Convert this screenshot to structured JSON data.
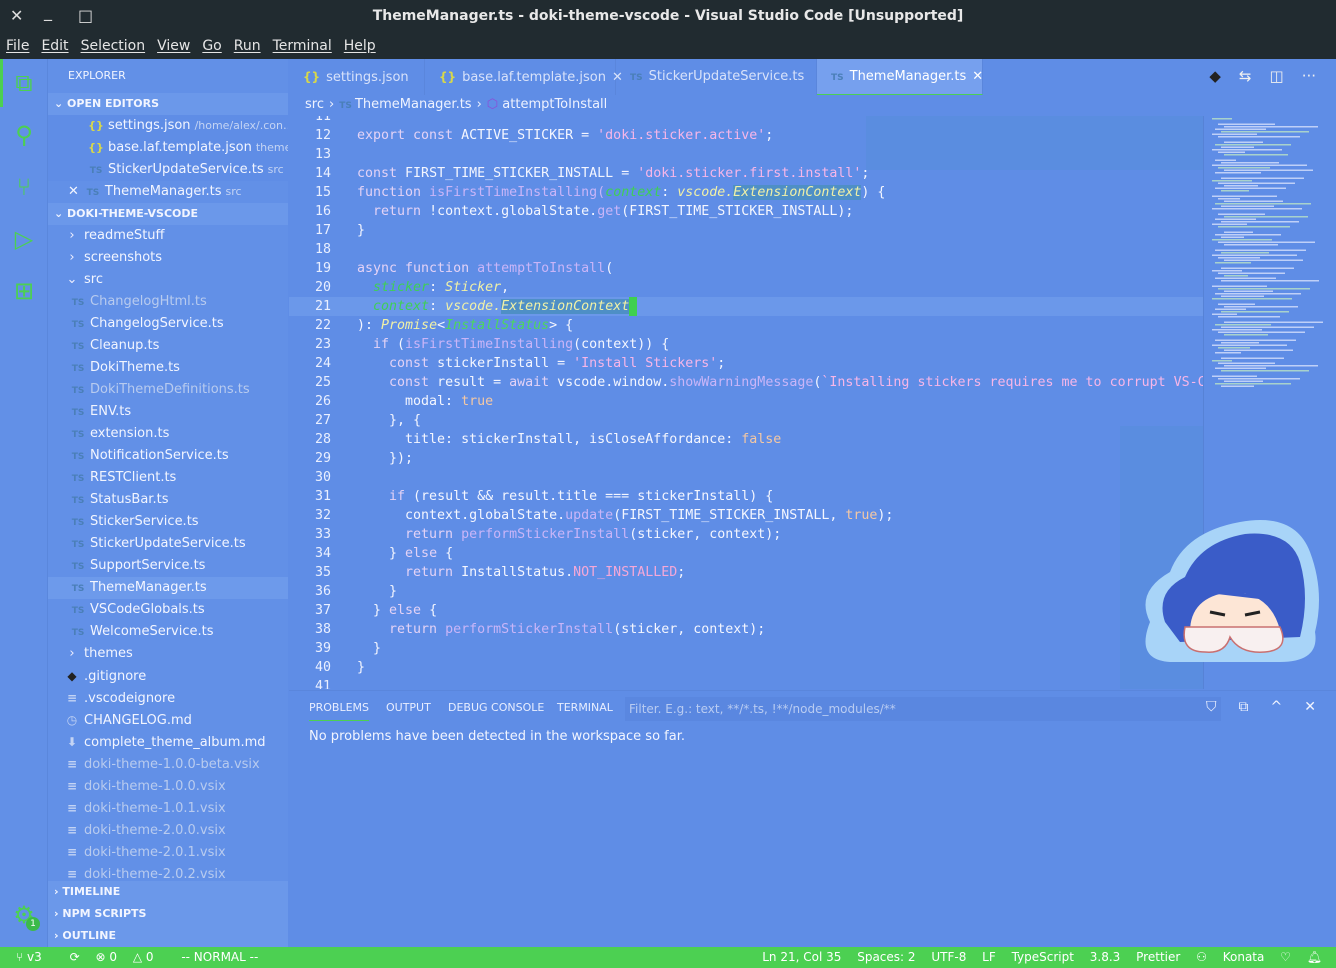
{
  "window": {
    "title": "ThemeManager.ts - doki-theme-vscode - Visual Studio Code [Unsupported]",
    "close": "✕",
    "minimize": "_",
    "maximize": "□"
  },
  "menu": [
    "File",
    "Edit",
    "Selection",
    "View",
    "Go",
    "Run",
    "Terminal",
    "Help"
  ],
  "activity": [
    {
      "icon": "files-icon"
    },
    {
      "icon": "search-icon"
    },
    {
      "icon": "source-control-icon"
    },
    {
      "icon": "run-debug-icon"
    },
    {
      "icon": "extensions-icon"
    },
    {
      "icon": "settings-gear-icon",
      "badge": "1"
    }
  ],
  "sidebar": {
    "title": "EXPLORER",
    "open_editors": {
      "label": "OPEN EDITORS",
      "items": [
        {
          "icon": "{}",
          "name": "settings.json",
          "desc": "/home/alex/.con…"
        },
        {
          "icon": "{}",
          "name": "base.laf.template.json",
          "desc": "theme…"
        },
        {
          "icon": "TS",
          "name": "StickerUpdateService.ts",
          "desc": "src"
        },
        {
          "icon": "TS",
          "name": "ThemeManager.ts",
          "desc": "src",
          "close": "✕"
        }
      ]
    },
    "project": {
      "label": "DOKI-THEME-VSCODE",
      "items": [
        {
          "indent": 1,
          "icon": "›",
          "name": "readmeStuff"
        },
        {
          "indent": 1,
          "icon": "›",
          "name": "screenshots"
        },
        {
          "indent": 1,
          "icon": "⌄",
          "name": "src"
        },
        {
          "indent": 2,
          "icon": "TS",
          "name": "ChangelogHtml.ts",
          "dim": true
        },
        {
          "indent": 2,
          "icon": "TS",
          "name": "ChangelogService.ts"
        },
        {
          "indent": 2,
          "icon": "TS",
          "name": "Cleanup.ts"
        },
        {
          "indent": 2,
          "icon": "TS",
          "name": "DokiTheme.ts"
        },
        {
          "indent": 2,
          "icon": "TS",
          "name": "DokiThemeDefinitions.ts",
          "dim": true
        },
        {
          "indent": 2,
          "icon": "TS",
          "name": "ENV.ts"
        },
        {
          "indent": 2,
          "icon": "TS",
          "name": "extension.ts"
        },
        {
          "indent": 2,
          "icon": "TS",
          "name": "NotificationService.ts"
        },
        {
          "indent": 2,
          "icon": "TS",
          "name": "RESTClient.ts"
        },
        {
          "indent": 2,
          "icon": "TS",
          "name": "StatusBar.ts"
        },
        {
          "indent": 2,
          "icon": "TS",
          "name": "StickerService.ts"
        },
        {
          "indent": 2,
          "icon": "TS",
          "name": "StickerUpdateService.ts"
        },
        {
          "indent": 2,
          "icon": "TS",
          "name": "SupportService.ts"
        },
        {
          "indent": 2,
          "icon": "TS",
          "name": "ThemeManager.ts",
          "selected": true
        },
        {
          "indent": 2,
          "icon": "TS",
          "name": "VSCodeGlobals.ts"
        },
        {
          "indent": 2,
          "icon": "TS",
          "name": "WelcomeService.ts"
        },
        {
          "indent": 1,
          "icon": "›",
          "name": "themes"
        },
        {
          "indent": 1,
          "icon": "◆",
          "name": ".gitignore"
        },
        {
          "indent": 1,
          "icon": "≡",
          "name": ".vscodeignore"
        },
        {
          "indent": 1,
          "icon": "◷",
          "name": "CHANGELOG.md"
        },
        {
          "indent": 1,
          "icon": "⬇",
          "name": "complete_theme_album.md"
        },
        {
          "indent": 1,
          "icon": "≡",
          "name": "doki-theme-1.0.0-beta.vsix",
          "dim": true
        },
        {
          "indent": 1,
          "icon": "≡",
          "name": "doki-theme-1.0.0.vsix",
          "dim": true
        },
        {
          "indent": 1,
          "icon": "≡",
          "name": "doki-theme-1.0.1.vsix",
          "dim": true
        },
        {
          "indent": 1,
          "icon": "≡",
          "name": "doki-theme-2.0.0.vsix",
          "dim": true
        },
        {
          "indent": 1,
          "icon": "≡",
          "name": "doki-theme-2.0.1.vsix",
          "dim": true
        },
        {
          "indent": 1,
          "icon": "≡",
          "name": "doki-theme-2.0.2.vsix",
          "dim": true
        }
      ]
    },
    "bottom_sections": [
      "TIMELINE",
      "NPM SCRIPTS",
      "OUTLINE"
    ]
  },
  "tabs": [
    {
      "icon": "{}",
      "label": "settings.json"
    },
    {
      "icon": "{}",
      "label": "base.laf.template.json",
      "close": "✕"
    },
    {
      "icon": "TS",
      "label": "StickerUpdateService.ts"
    },
    {
      "icon": "TS",
      "label": "ThemeManager.ts",
      "close": "✕",
      "active": true
    }
  ],
  "tab_actions": [
    "git-compare-icon",
    "open-changes-icon",
    "split-editor-icon",
    "more-actions-icon"
  ],
  "breadcrumb": {
    "folder": "src",
    "file": "ThemeManager.ts",
    "symbol": "attemptToInstall"
  },
  "editor": {
    "current_line": 21,
    "lines": [
      {
        "n": 11,
        "t": []
      },
      {
        "n": 12,
        "t": [
          [
            "kw",
            "export const "
          ],
          [
            "pl",
            "ACTIVE_STICKER = "
          ],
          [
            "str",
            "'doki.sticker.active'"
          ],
          [
            "pl",
            ";"
          ]
        ]
      },
      {
        "n": 13,
        "t": []
      },
      {
        "n": 14,
        "t": [
          [
            "kw",
            "const "
          ],
          [
            "pl",
            "FIRST_TIME_STICKER_INSTALL = "
          ],
          [
            "str",
            "'doki.sticker.first.install'"
          ],
          [
            "pl",
            ";"
          ]
        ]
      },
      {
        "n": 15,
        "t": [
          [
            "kw",
            "function "
          ],
          [
            "fn",
            "isFirstTimeInstalling("
          ],
          [
            "prm",
            "context"
          ],
          [
            "pl",
            ": "
          ],
          [
            "ty",
            "vscode."
          ],
          [
            "ty hl",
            "ExtensionContext"
          ],
          [
            "pl",
            ") {"
          ]
        ]
      },
      {
        "n": 16,
        "t": [
          [
            "kw",
            "  return "
          ],
          [
            "pl",
            "!context.globalState."
          ],
          [
            "fn",
            "get"
          ],
          [
            "pl",
            "(FIRST_TIME_STICKER_INSTALL);"
          ]
        ]
      },
      {
        "n": 17,
        "t": [
          [
            "pl",
            "}"
          ]
        ]
      },
      {
        "n": 18,
        "t": []
      },
      {
        "n": 19,
        "t": [
          [
            "kw",
            "async function "
          ],
          [
            "fn",
            "attemptToInstall"
          ],
          [
            "pl",
            "("
          ]
        ]
      },
      {
        "n": 20,
        "t": [
          [
            "pl",
            "  "
          ],
          [
            "prm",
            "sticker"
          ],
          [
            "pl",
            ": "
          ],
          [
            "ty",
            "Sticker"
          ],
          [
            "pl",
            ","
          ]
        ]
      },
      {
        "n": 21,
        "t": [
          [
            "pl",
            "  "
          ],
          [
            "prm",
            "context"
          ],
          [
            "pl",
            ": "
          ],
          [
            "ty",
            "vscode."
          ],
          [
            "ty hl",
            "ExtensionContext"
          ]
        ]
      },
      {
        "n": 22,
        "t": [
          [
            "pl",
            "): "
          ],
          [
            "ty",
            "Promise"
          ],
          [
            "pl",
            "<"
          ],
          [
            "tyg",
            "InstallStatus"
          ],
          [
            "pl",
            "> {"
          ]
        ]
      },
      {
        "n": 23,
        "t": [
          [
            "kw",
            "  if "
          ],
          [
            "pl",
            "("
          ],
          [
            "fn",
            "isFirstTimeInstalling"
          ],
          [
            "pl",
            "(context)) {"
          ]
        ]
      },
      {
        "n": 24,
        "t": [
          [
            "kw",
            "    const "
          ],
          [
            "pl",
            "stickerInstall = "
          ],
          [
            "str",
            "'Install Stickers'"
          ],
          [
            "pl",
            ";"
          ]
        ]
      },
      {
        "n": 25,
        "t": [
          [
            "kw",
            "    const "
          ],
          [
            "pl",
            "result = "
          ],
          [
            "kw",
            "await "
          ],
          [
            "pl",
            "vscode.window."
          ],
          [
            "fn",
            "showWarningMessage"
          ],
          [
            "pl",
            "("
          ],
          [
            "str",
            "`Installing stickers requires me to corrupt VS-Code t"
          ]
        ]
      },
      {
        "n": 26,
        "t": [
          [
            "pl",
            "      modal: "
          ],
          [
            "bool",
            "true"
          ]
        ]
      },
      {
        "n": 27,
        "t": [
          [
            "pl",
            "    }, {"
          ]
        ]
      },
      {
        "n": 28,
        "t": [
          [
            "pl",
            "      title: stickerInstall, isCloseAffordance: "
          ],
          [
            "bool",
            "false"
          ]
        ]
      },
      {
        "n": 29,
        "t": [
          [
            "pl",
            "    });"
          ]
        ]
      },
      {
        "n": 30,
        "t": []
      },
      {
        "n": 31,
        "t": [
          [
            "kw",
            "    if "
          ],
          [
            "pl",
            "(result && result.title === stickerInstall) {"
          ]
        ]
      },
      {
        "n": 32,
        "t": [
          [
            "pl",
            "      context.globalState."
          ],
          [
            "fn",
            "update"
          ],
          [
            "pl",
            "(FIRST_TIME_STICKER_INSTALL, "
          ],
          [
            "bool",
            "true"
          ],
          [
            "pl",
            ");"
          ]
        ]
      },
      {
        "n": 33,
        "t": [
          [
            "kw",
            "      return "
          ],
          [
            "fn",
            "performStickerInstall"
          ],
          [
            "pl",
            "(sticker, context);"
          ]
        ]
      },
      {
        "n": 34,
        "t": [
          [
            "pl",
            "    } "
          ],
          [
            "kw",
            "else "
          ],
          [
            "pl",
            "{"
          ]
        ]
      },
      {
        "n": 35,
        "t": [
          [
            "kw",
            "      return "
          ],
          [
            "pl",
            "InstallStatus."
          ],
          [
            "cst",
            "NOT_INSTALLED"
          ],
          [
            "pl",
            ";"
          ]
        ]
      },
      {
        "n": 36,
        "t": [
          [
            "pl",
            "    }"
          ]
        ]
      },
      {
        "n": 37,
        "t": [
          [
            "pl",
            "  } "
          ],
          [
            "kw",
            "else "
          ],
          [
            "pl",
            "{"
          ]
        ]
      },
      {
        "n": 38,
        "t": [
          [
            "kw",
            "    return "
          ],
          [
            "fn",
            "performStickerInstall"
          ],
          [
            "pl",
            "(sticker, context);"
          ]
        ]
      },
      {
        "n": 39,
        "t": [
          [
            "pl",
            "  }"
          ]
        ]
      },
      {
        "n": 40,
        "t": [
          [
            "pl",
            "}"
          ]
        ]
      },
      {
        "n": 41,
        "t": []
      }
    ]
  },
  "panel": {
    "tabs": [
      "PROBLEMS",
      "OUTPUT",
      "DEBUG CONSOLE",
      "TERMINAL"
    ],
    "active_tab": "PROBLEMS",
    "filter_placeholder": "Filter. E.g.: text, **/*.ts, !**/node_modules/**",
    "message": "No problems have been detected in the workspace so far.",
    "actions": [
      "filter-icon",
      "collapse-all-icon",
      "maximize-panel-icon",
      "close-panel-icon"
    ]
  },
  "statusbar": {
    "branch": "v3",
    "sync": "⟳",
    "errors": "0",
    "warnings": "0",
    "mode": "-- NORMAL --",
    "position": "Ln 21, Col 35",
    "spaces": "Spaces: 2",
    "encoding": "UTF-8",
    "eol": "LF",
    "language": "TypeScript",
    "version": "3.8.3",
    "formatter": "Prettier",
    "theme": "Konata",
    "color": "#4cd052"
  },
  "colors": {
    "background": "#5f8de6",
    "accent": "#4cd052",
    "titlebar": "#212b30"
  }
}
